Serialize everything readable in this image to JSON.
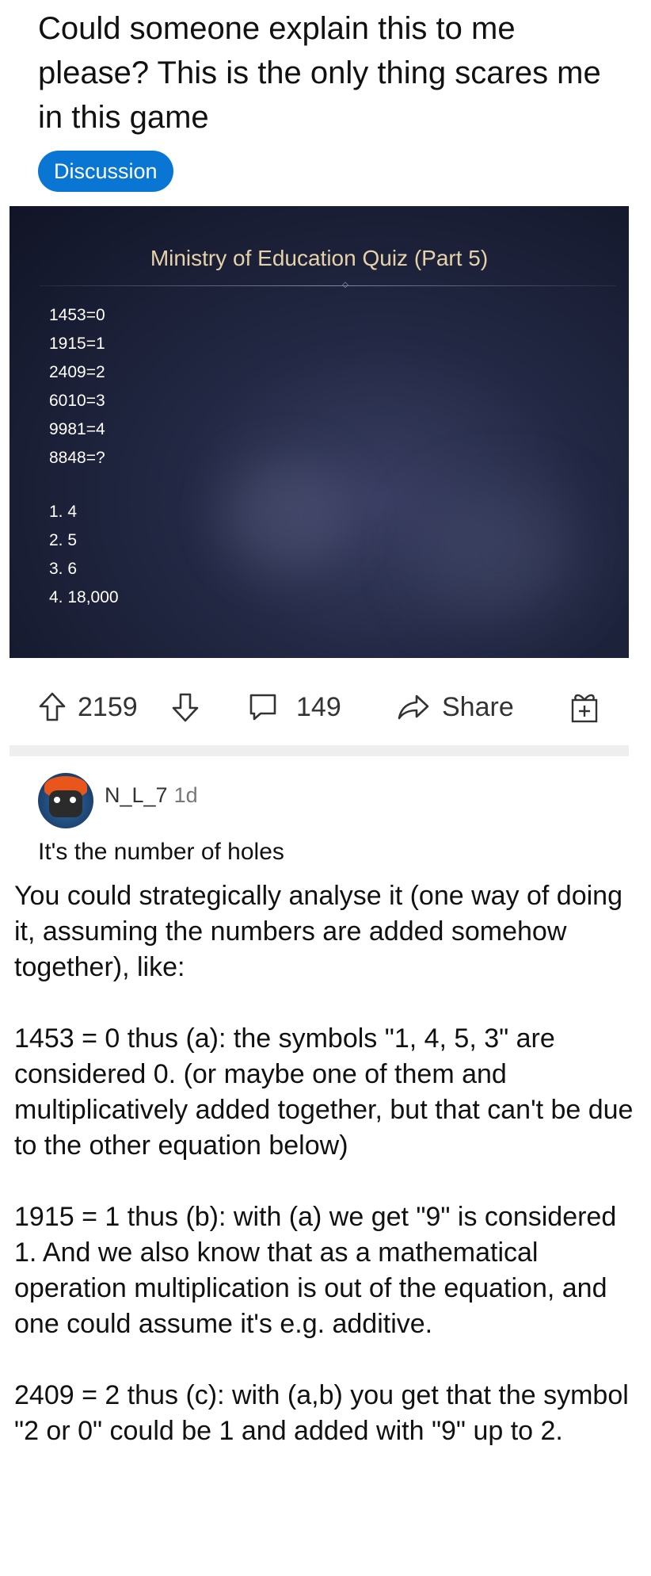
{
  "post": {
    "title": "Could someone explain this to me please? This is the only thing scares me in this game",
    "flair": "Discussion",
    "colors": {
      "flair_bg": "#0a76d4",
      "quiz_title": "#e6d2a8"
    }
  },
  "quiz": {
    "title": "Ministry of Education Quiz (Part 5)",
    "lines": [
      "1453=0",
      "1915=1",
      "2409=2",
      "6010=3",
      "9981=4",
      "8848=?"
    ],
    "options": [
      "1. 4",
      "2. 5",
      "3. 6",
      "4. 18,000"
    ]
  },
  "actions": {
    "upvote_icon": "arrow-up-icon",
    "score": "2159",
    "downvote_icon": "arrow-down-icon",
    "comment_icon": "speech-bubble-icon",
    "comments": "149",
    "share_icon": "share-arrow-icon",
    "share_label": "Share",
    "award_icon": "gift-icon"
  },
  "comment": {
    "author": "N_L_7",
    "time": "1d",
    "first_line": "It's the number of holes",
    "paragraphs": [
      "You could strategically analyse it (one way of doing it, assuming the numbers are added somehow together), like:",
      "1453 = 0 thus (a): the symbols \"1, 4, 5, 3\" are considered 0. (or maybe one of them and multiplicatively added together, but that can't be due to the other equation below)",
      "1915 = 1 thus (b): with (a) we get \"9\" is considered 1. And we also know that as a mathematical operation multiplication is out of the equation, and one could assume it's e.g. additive.",
      "2409 = 2 thus (c): with (a,b) you get that the symbol \"2 or 0\" could be 1 and added with \"9\" up to 2."
    ]
  }
}
